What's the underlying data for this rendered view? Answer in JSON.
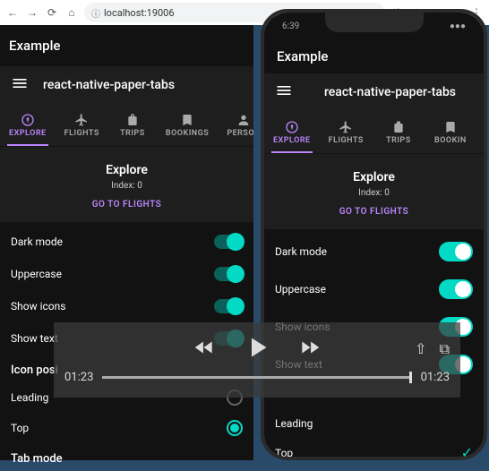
{
  "browser": {
    "url": "localhost:19006"
  },
  "left": {
    "title": "Example",
    "appbar_title": "react-native-paper-tabs",
    "tabs": [
      {
        "label": "EXPLORE",
        "active": true
      },
      {
        "label": "FLIGHTS"
      },
      {
        "label": "TRIPS"
      },
      {
        "label": "BOOKINGS"
      },
      {
        "label": "PERSON"
      }
    ],
    "content": {
      "heading": "Explore",
      "subtitle": "Index: 0",
      "cta": "GO TO FLIGHTS"
    },
    "toggles": {
      "dark_mode": "Dark mode",
      "uppercase": "Uppercase",
      "show_icons": "Show icons",
      "show_text": "Show text"
    },
    "icon_position_header": "Icon posi",
    "options": {
      "leading": "Leading",
      "top": "Top"
    },
    "tab_mode_header": "Tab mode"
  },
  "right": {
    "status_time": "6:39",
    "title": "Example",
    "appbar_title": "react-native-paper-tabs",
    "tabs": [
      {
        "label": "EXPLORE",
        "active": true
      },
      {
        "label": "FLIGHTS"
      },
      {
        "label": "TRIPS"
      },
      {
        "label": "BOOKIN"
      }
    ],
    "content": {
      "heading": "Explore",
      "subtitle": "Index: 0",
      "cta": "GO TO FLIGHTS"
    },
    "toggles": {
      "dark_mode": "Dark mode",
      "uppercase": "Uppercase",
      "show_icons": "Show icons",
      "show_text": "Show text"
    },
    "options": {
      "leading": "Leading",
      "top": "Top"
    }
  },
  "video": {
    "current_time": "01:23",
    "total_time": "01:23"
  }
}
